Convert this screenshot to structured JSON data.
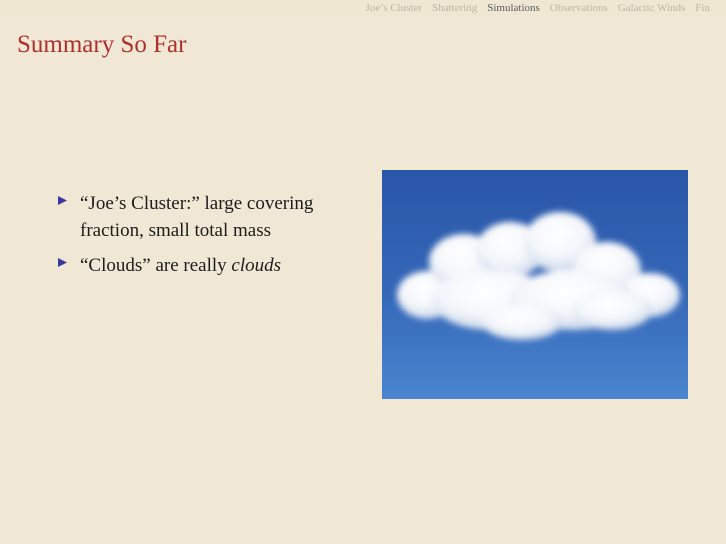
{
  "navbar": {
    "items": [
      {
        "label": "Joe’s Cluster"
      },
      {
        "label": "Shattering"
      },
      {
        "label": "Simulations"
      },
      {
        "label": "Observations"
      },
      {
        "label": "Galactic Winds"
      },
      {
        "label": "Fin"
      }
    ],
    "active": "Simulations"
  },
  "slide": {
    "title": "Summary So Far",
    "bullets": [
      {
        "text": "“Joe’s Cluster:” large covering fraction, small total mass"
      },
      {
        "text_before": "“Clouds” are really ",
        "text_emph": "clouds"
      }
    ]
  },
  "colors": {
    "background": "#f0e8d4",
    "title": "#b0302e",
    "bullet_marker": "#3a3a9e",
    "sky_top": "#2a56a8",
    "sky_bottom": "#4a86d0"
  },
  "image": {
    "icon": "cloud-photo"
  }
}
